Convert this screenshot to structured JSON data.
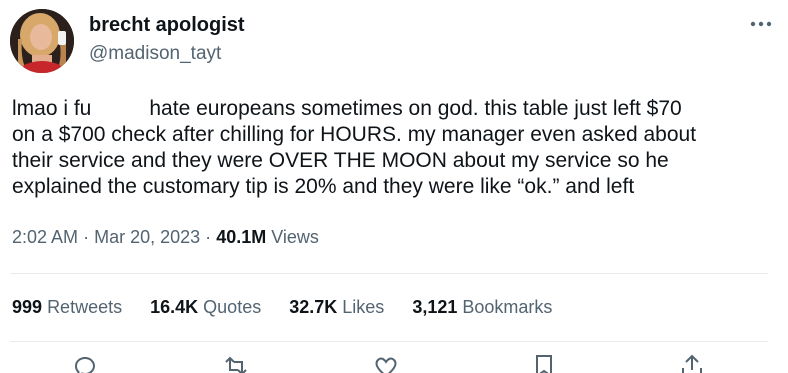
{
  "author": {
    "display_name": "brecht apologist",
    "handle": "@madison_tayt",
    "avatar_icon": "profile-photo"
  },
  "tweet": {
    "lines": [
      [
        "lmao i fu",
        "hate europeans sometimes on god. this table just left $70"
      ],
      "on a $700 check after chilling for HOURS. my manager even asked about",
      "their service and they were OVER THE MOON about my service so he",
      "explained the customary tip is 20% and they were like “ok.” and left"
    ],
    "time": "2:02 AM",
    "date": "Mar 20, 2023",
    "views_count": "40.1M",
    "views_label": "Views",
    "separator": "·"
  },
  "stats": {
    "retweets_count": "999",
    "retweets_label": "Retweets",
    "quotes_count": "16.4K",
    "quotes_label": "Quotes",
    "likes_count": "32.7K",
    "likes_label": "Likes",
    "bookmarks_count": "3,121",
    "bookmarks_label": "Bookmarks"
  },
  "icons": {
    "more": "more-horizontal-icon",
    "reply": "reply-icon",
    "retweet": "retweet-icon",
    "like": "heart-icon",
    "bookmark": "bookmark-icon",
    "share": "share-icon"
  },
  "colors": {
    "text_primary": "#0f1419",
    "text_secondary": "#536471",
    "divider": "#e7eaed"
  }
}
